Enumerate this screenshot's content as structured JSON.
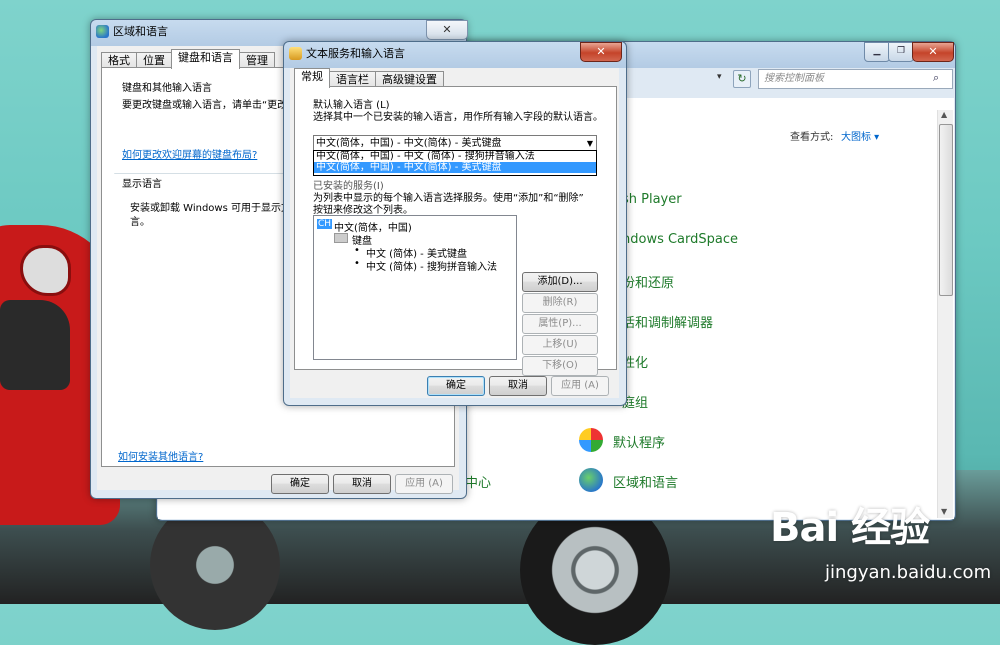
{
  "control_panel": {
    "search_placeholder": "搜索控制面板",
    "view_by_label": "查看方式:",
    "view_by_value": "大图标 ▾",
    "items": [
      "sh Player",
      "ndows CardSpace",
      "份和还原",
      "活和调制解调器",
      "性化",
      "庭组",
      "默认程序",
      "区域和语言",
      "中心"
    ]
  },
  "region_language": {
    "title": "区域和语言",
    "tabs": [
      "格式",
      "位置",
      "键盘和语言",
      "管理"
    ],
    "selected_tab": "键盘和语言",
    "keyboard_group_label": "键盘和其他输入语言",
    "keyboard_desc": "要更改键盘或输入语言，请单击“更改",
    "keyboard_link": "如何更改欢迎屏幕的键盘布局?",
    "display_group_label": "显示语言",
    "display_desc_1": "安装或卸载 Windows 可用于显示文本",
    "display_desc_2": "言。",
    "install_link": "如何安装其他语言?",
    "ok": "确定",
    "cancel": "取消",
    "apply": "应用 (A)"
  },
  "text_services": {
    "title": "文本服务和输入语言",
    "tabs": [
      "常规",
      "语言栏",
      "高级键设置"
    ],
    "default_label": "默认输入语言 (L)",
    "default_desc": "选择其中一个已安装的输入语言，用作所有输入字段的默认语言。",
    "combo_value": "中文(简体，中国) - 中文(简体) - 美式键盘",
    "dropdown_options": [
      "中文(简体，中国) - 中文 (简体) - 搜狗拼音输入法",
      "中文(简体，中国) - 中文(简体) - 美式键盘"
    ],
    "services_label": "已安装的服务(I)",
    "services_desc_1": "为列表中显示的每个输入语言选择服务。使用“添加”和“删除”",
    "services_desc_2": "按钮来修改这个列表。",
    "tree": {
      "lang_badge": "CH",
      "lang": "中文(简体，中国)",
      "keyboard": "键盘",
      "item1": "中文 (简体) - 美式键盘",
      "item2": "中文 (简体) - 搜狗拼音输入法"
    },
    "buttons": {
      "add": "添加(D)...",
      "remove": "删除(R)",
      "properties": "属性(P)...",
      "move_up": "上移(U)",
      "move_down": "下移(O)"
    },
    "ok": "确定",
    "cancel": "取消",
    "apply": "应用 (A)"
  },
  "watermark": {
    "brand": "Bai 经验",
    "url": "jingyan.baidu.com"
  }
}
